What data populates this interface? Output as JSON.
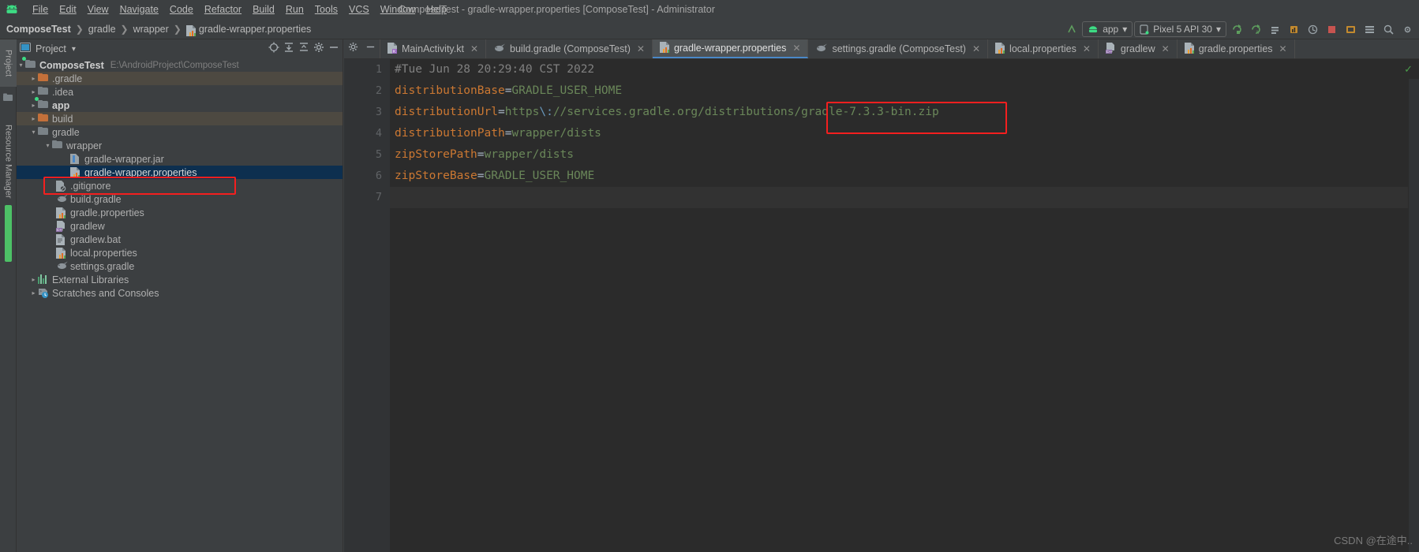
{
  "window": {
    "title": "ComposeTest - gradle-wrapper.properties [ComposeTest] - Administrator",
    "logo_icon": "android-logo-icon"
  },
  "menubar": {
    "items": [
      {
        "label": "File",
        "mnemonic": "F"
      },
      {
        "label": "Edit",
        "mnemonic": "E"
      },
      {
        "label": "View",
        "mnemonic": "V"
      },
      {
        "label": "Navigate",
        "mnemonic": "N"
      },
      {
        "label": "Code",
        "mnemonic": "C"
      },
      {
        "label": "Refactor",
        "mnemonic": "R"
      },
      {
        "label": "Build",
        "mnemonic": "B"
      },
      {
        "label": "Run",
        "mnemonic": "u"
      },
      {
        "label": "Tools",
        "mnemonic": "T"
      },
      {
        "label": "VCS",
        "mnemonic": "S"
      },
      {
        "label": "Window",
        "mnemonic": "W"
      },
      {
        "label": "Help",
        "mnemonic": "H"
      }
    ]
  },
  "navbar": {
    "breadcrumbs": [
      {
        "label": "ComposeTest",
        "bold": true,
        "icon": ""
      },
      {
        "label": "gradle",
        "bold": false,
        "icon": ""
      },
      {
        "label": "wrapper",
        "bold": false,
        "icon": ""
      },
      {
        "label": "gradle-wrapper.properties",
        "bold": false,
        "icon": "properties-file-icon"
      }
    ],
    "separator": "❯",
    "run_config": {
      "label": "app",
      "icon": "android-module-icon",
      "caret": "▾"
    },
    "device": {
      "label": "Pixel 5 API 30",
      "icon": "device-icon",
      "caret": "▾"
    },
    "buttons": [
      {
        "name": "make-project-button",
        "glyph": "↖"
      },
      {
        "name": "run-button",
        "glyph": "↻"
      },
      {
        "name": "apply-changes-button",
        "glyph": "↻"
      },
      {
        "name": "debug-button",
        "glyph": "≣"
      },
      {
        "name": "profile-button",
        "glyph": "⚑"
      },
      {
        "name": "attach-debugger-button",
        "glyph": "↪"
      },
      {
        "name": "stop-button",
        "glyph": "■"
      },
      {
        "name": "avd-manager-button",
        "glyph": "⚙"
      },
      {
        "name": "sdk-manager-button",
        "glyph": "☰"
      },
      {
        "name": "search-everywhere-button",
        "glyph": "⌕"
      },
      {
        "name": "settings-button",
        "glyph": "⚙"
      }
    ]
  },
  "tool_stripe": {
    "items": [
      {
        "label": "Project",
        "selected": true,
        "name": "stripe-project"
      },
      {
        "label": "",
        "selected": false,
        "name": "stripe-folder-icon"
      },
      {
        "label": "Resource Manager",
        "selected": false,
        "name": "stripe-resource-manager"
      }
    ]
  },
  "project_panel": {
    "title": "Project",
    "title_caret": "▾",
    "actions": [
      {
        "name": "select-opened-file-icon",
        "glyph": "⊕"
      },
      {
        "name": "expand-all-icon",
        "glyph": "↧"
      },
      {
        "name": "collapse-all-icon",
        "glyph": "↥"
      },
      {
        "name": "settings-gear-icon",
        "glyph": "⚙"
      },
      {
        "name": "hide-panel-icon",
        "glyph": "−"
      }
    ],
    "tree": [
      {
        "label": "ComposeTest",
        "path": "E:\\AndroidProject\\ComposeTest",
        "indent": 0,
        "arrow": "down",
        "icon": "module-folder-icon",
        "bold": true,
        "state": "normal"
      },
      {
        "label": ".gradle",
        "path": "",
        "indent": 1,
        "arrow": "right",
        "icon": "excluded-folder-icon",
        "bold": false,
        "state": "tinted"
      },
      {
        "label": ".idea",
        "path": "",
        "indent": 1,
        "arrow": "right",
        "icon": "folder-icon",
        "bold": false,
        "state": "normal"
      },
      {
        "label": "app",
        "path": "",
        "indent": 1,
        "arrow": "right",
        "icon": "module-folder-icon",
        "bold": true,
        "state": "normal"
      },
      {
        "label": "build",
        "path": "",
        "indent": 1,
        "arrow": "right",
        "icon": "excluded-folder-icon",
        "bold": false,
        "state": "tinted"
      },
      {
        "label": "gradle",
        "path": "",
        "indent": 1,
        "arrow": "down",
        "icon": "folder-icon",
        "bold": false,
        "state": "normal"
      },
      {
        "label": "wrapper",
        "path": "",
        "indent": 2,
        "arrow": "down",
        "icon": "folder-icon",
        "bold": false,
        "state": "normal"
      },
      {
        "label": "gradle-wrapper.jar",
        "path": "",
        "indent": 3,
        "arrow": "none",
        "icon": "jar-file-icon",
        "bold": false,
        "state": "normal"
      },
      {
        "label": "gradle-wrapper.properties",
        "path": "",
        "indent": 3,
        "arrow": "none",
        "icon": "properties-file-icon",
        "bold": false,
        "state": "selected"
      },
      {
        "label": ".gitignore",
        "path": "",
        "indent": 2,
        "arrow": "none",
        "icon": "gitignore-file-icon",
        "bold": false,
        "state": "normal"
      },
      {
        "label": "build.gradle",
        "path": "",
        "indent": 2,
        "arrow": "none",
        "icon": "gradle-file-icon",
        "bold": false,
        "state": "normal"
      },
      {
        "label": "gradle.properties",
        "path": "",
        "indent": 2,
        "arrow": "none",
        "icon": "properties-file-icon",
        "bold": false,
        "state": "normal"
      },
      {
        "label": "gradlew",
        "path": "",
        "indent": 2,
        "arrow": "none",
        "icon": "cpp-file-icon",
        "bold": false,
        "state": "normal"
      },
      {
        "label": "gradlew.bat",
        "path": "",
        "indent": 2,
        "arrow": "none",
        "icon": "bat-file-icon",
        "bold": false,
        "state": "normal"
      },
      {
        "label": "local.properties",
        "path": "",
        "indent": 2,
        "arrow": "none",
        "icon": "properties-file-icon",
        "bold": false,
        "state": "normal"
      },
      {
        "label": "settings.gradle",
        "path": "",
        "indent": 2,
        "arrow": "none",
        "icon": "gradle-file-icon",
        "bold": false,
        "state": "normal"
      },
      {
        "label": "External Libraries",
        "path": "",
        "indent": 0,
        "arrow": "right",
        "icon": "libraries-icon",
        "bold": false,
        "state": "normal"
      },
      {
        "label": "Scratches and Consoles",
        "path": "",
        "indent": 0,
        "arrow": "right",
        "icon": "scratches-icon",
        "bold": false,
        "state": "normal"
      }
    ]
  },
  "editor": {
    "tab_controls": [
      {
        "name": "editor-gear-icon",
        "glyph": "⚙"
      },
      {
        "name": "editor-hide-icon",
        "glyph": "−"
      }
    ],
    "tabs": [
      {
        "label": "MainActivity.kt",
        "icon": "kotlin-file-icon",
        "active": false,
        "close": "✕"
      },
      {
        "label": "build.gradle (ComposeTest)",
        "icon": "gradle-file-icon",
        "active": false,
        "close": "✕"
      },
      {
        "label": "gradle-wrapper.properties",
        "icon": "properties-file-icon",
        "active": true,
        "close": "✕"
      },
      {
        "label": "settings.gradle (ComposeTest)",
        "icon": "gradle-file-icon",
        "active": false,
        "close": "✕"
      },
      {
        "label": "local.properties",
        "icon": "properties-file-icon",
        "active": false,
        "close": "✕"
      },
      {
        "label": "gradlew",
        "icon": "cpp-file-icon",
        "active": false,
        "close": "✕"
      },
      {
        "label": "gradle.properties",
        "icon": "properties-file-icon",
        "active": false,
        "close": "✕"
      }
    ],
    "inspection_ok_glyph": "✓",
    "line_numbers": [
      "1",
      "2",
      "3",
      "4",
      "5",
      "6",
      "7"
    ],
    "code": [
      {
        "type": "comment",
        "text": "#Tue Jun 28 20:29:40 CST 2022"
      },
      {
        "type": "pair",
        "key": "distributionBase",
        "value": "GRADLE_USER_HOME"
      },
      {
        "type": "url",
        "key": "distributionUrl",
        "value_pre": "https",
        "escape": "\\:",
        "value_post": "//services.gradle.org/distributions/gradle-7.3.3-bin.zip"
      },
      {
        "type": "pair",
        "key": "distributionPath",
        "value": "wrapper/dists"
      },
      {
        "type": "pair",
        "key": "zipStorePath",
        "value": "wrapper/dists"
      },
      {
        "type": "pair",
        "key": "zipStoreBase",
        "value": "GRADLE_USER_HOME"
      },
      {
        "type": "empty",
        "text": ""
      }
    ]
  },
  "annotations": {
    "box_color": "#f41f1f",
    "boxes": [
      {
        "name": "annotation-box-gradle-version",
        "target": "gradle-7.3.3-bin.zip"
      },
      {
        "name": "annotation-box-selected-file",
        "target": "gradle-wrapper.properties"
      }
    ]
  },
  "watermark": "CSDN @在途中.."
}
